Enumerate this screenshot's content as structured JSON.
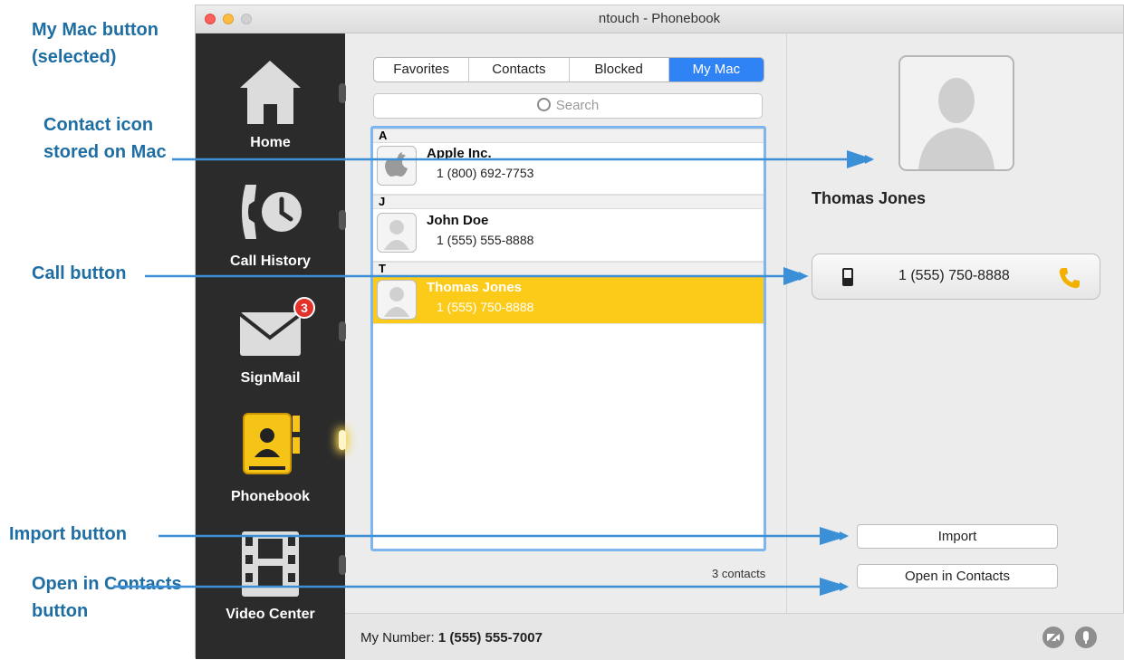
{
  "callouts": {
    "my_mac": "My Mac button (selected)",
    "contact_icon": "Contact icon stored on Mac",
    "call_button": "Call button",
    "import_button": "Import button",
    "open_in_contacts": "Open in Contacts button"
  },
  "window": {
    "title": "ntouch - Phonebook"
  },
  "sidebar": {
    "items": [
      {
        "label": "Home",
        "icon": "home-icon"
      },
      {
        "label": "Call History",
        "icon": "call-history-icon"
      },
      {
        "label": "SignMail",
        "icon": "mail-icon",
        "badge": "3"
      },
      {
        "label": "Phonebook",
        "icon": "phonebook-icon",
        "active": true
      },
      {
        "label": "Video Center",
        "icon": "film-icon"
      }
    ]
  },
  "tabs": [
    {
      "label": "Favorites"
    },
    {
      "label": "Contacts"
    },
    {
      "label": "Blocked"
    },
    {
      "label": "My Mac",
      "selected": true
    }
  ],
  "search": {
    "placeholder": "Search"
  },
  "list": {
    "sections": [
      {
        "letter": "A",
        "contacts": [
          {
            "name": "Apple Inc.",
            "number": "1 (800) 692-7753"
          }
        ]
      },
      {
        "letter": "J",
        "contacts": [
          {
            "name": "John Doe",
            "number": "1 (555) 555-8888"
          }
        ]
      },
      {
        "letter": "T",
        "contacts": [
          {
            "name": "Thomas Jones",
            "number": "1 (555) 750-8888",
            "selected": true
          }
        ]
      }
    ],
    "count": "3 contacts"
  },
  "detail": {
    "name": "Thomas Jones",
    "call_number": "1 (555) 750-8888",
    "import_label": "Import",
    "open_label": "Open in Contacts"
  },
  "footer": {
    "my_number_label": "My Number:",
    "my_number": "1 (555) 555-7007"
  },
  "colors": {
    "accent": "#2f83f4",
    "selected_row": "#fccb1a",
    "callout": "#1f6ea3",
    "sidebar": "#2b2b2b"
  }
}
